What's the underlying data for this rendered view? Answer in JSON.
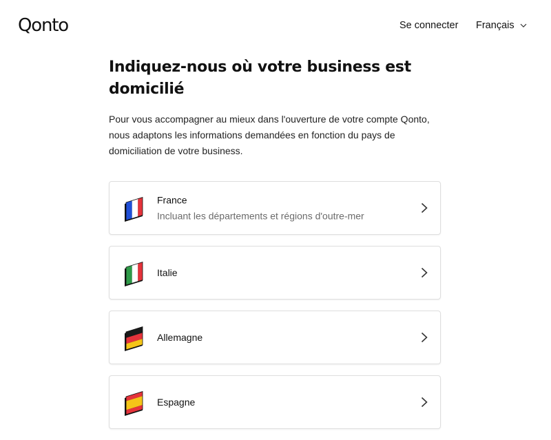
{
  "header": {
    "logo": "Qonto",
    "login_label": "Se connecter",
    "language_label": "Français"
  },
  "main": {
    "title": "Indiquez-nous où votre business est domicilié",
    "intro": "Pour vous accompagner au mieux dans l'ouverture de votre compte Qonto, nous adaptons les informations demandées en fonction du pays de domiciliation de votre business."
  },
  "countries": [
    {
      "name": "France",
      "subtitle": "Incluant les départements et régions d'outre-mer",
      "flag_icon": "france-flag-icon",
      "colors": [
        "#1f4fd8",
        "#ffffff",
        "#e5333b"
      ]
    },
    {
      "name": "Italie",
      "subtitle": "",
      "flag_icon": "italy-flag-icon",
      "colors": [
        "#2e9a48",
        "#ffffff",
        "#e5333b"
      ]
    },
    {
      "name": "Allemagne",
      "subtitle": "",
      "flag_icon": "germany-flag-icon",
      "colors": [
        "#1a1a1a",
        "#e5333b",
        "#f5c518"
      ]
    },
    {
      "name": "Espagne",
      "subtitle": "",
      "flag_icon": "spain-flag-icon",
      "colors": [
        "#e5333b",
        "#f5c518",
        "#e5333b"
      ]
    }
  ]
}
